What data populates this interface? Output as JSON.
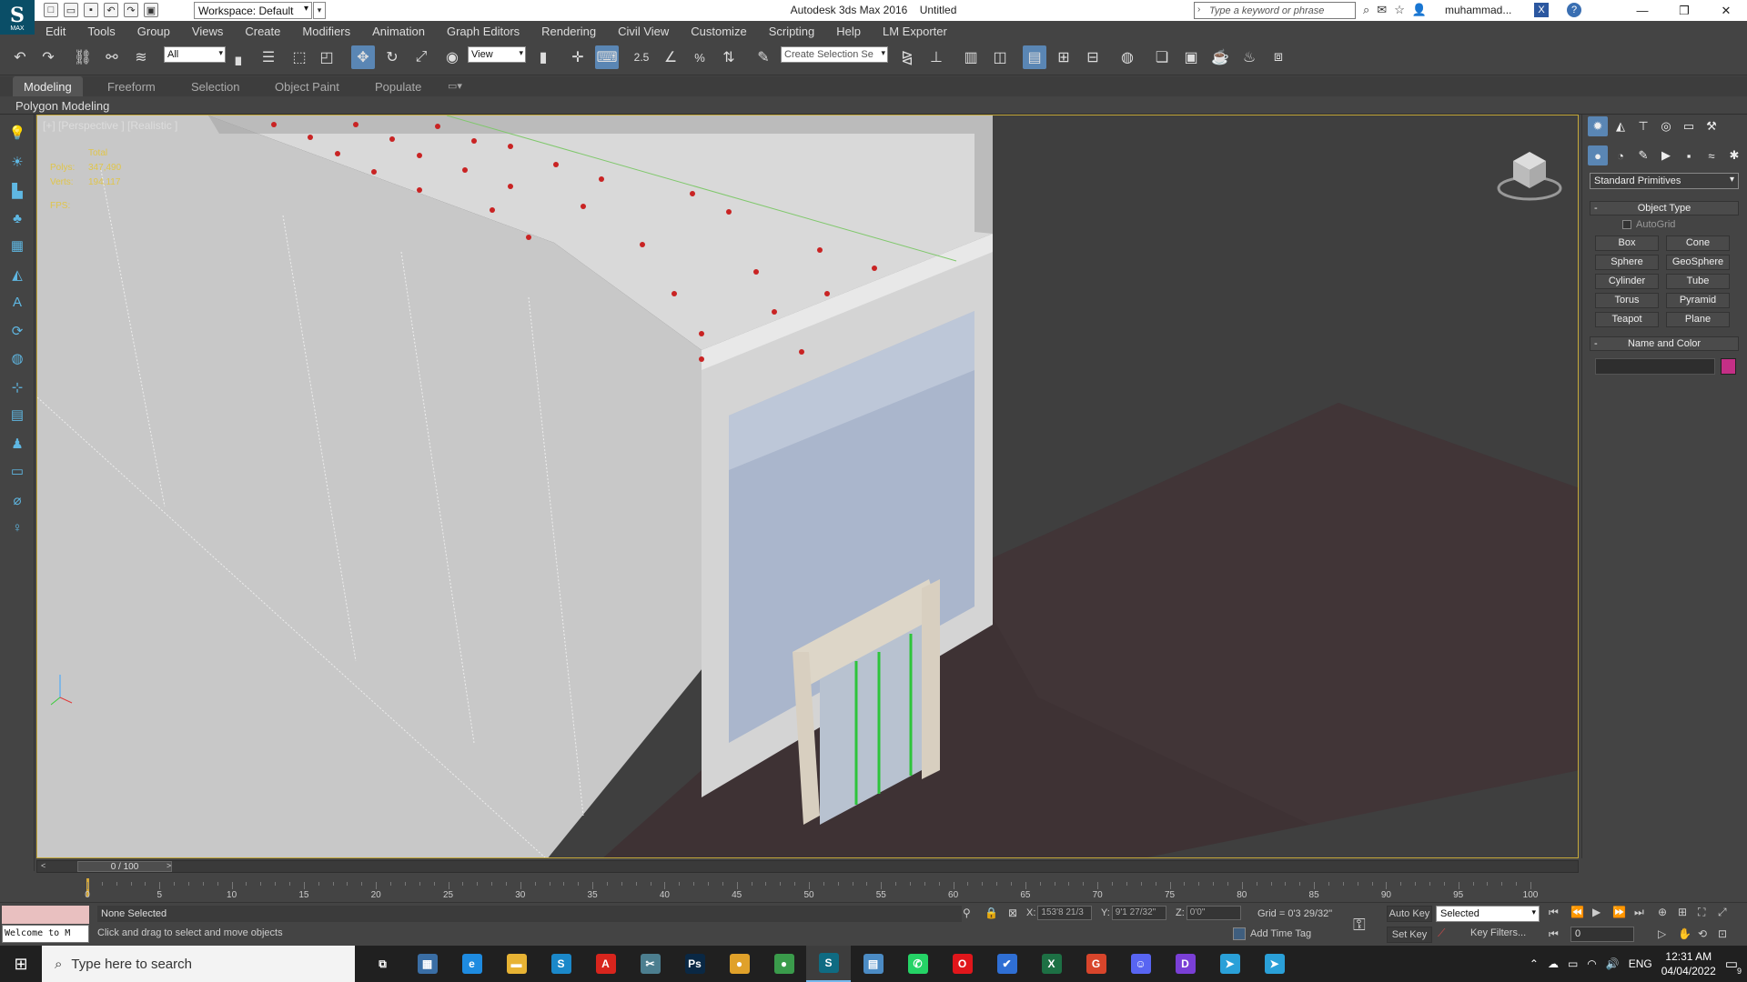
{
  "title_bar": {
    "app_title": "Autodesk 3ds Max 2016",
    "doc_title": "Untitled",
    "workspace": "Workspace: Default",
    "search_placeholder": "Type a keyword or phrase",
    "user": "muhammad...",
    "logo_text": "MAX"
  },
  "menu": [
    "Edit",
    "Tools",
    "Group",
    "Views",
    "Create",
    "Modifiers",
    "Animation",
    "Graph Editors",
    "Rendering",
    "Civil View",
    "Customize",
    "Scripting",
    "Help",
    "LM Exporter"
  ],
  "toolbar": {
    "filter": "All",
    "ref_coord": "View",
    "snap_value": "2.5",
    "selection_set_placeholder": "Create Selection Se"
  },
  "ribbon": {
    "tabs": [
      "Modeling",
      "Freeform",
      "Selection",
      "Object Paint",
      "Populate"
    ],
    "active_tab": "Modeling",
    "panel": "Polygon Modeling"
  },
  "viewport": {
    "label": "[+] [Perspective ] [Realistic ]",
    "stats": {
      "total_label": "Total",
      "polys_label": "Polys:",
      "polys": "347,490",
      "verts_label": "Verts:",
      "verts": "194,117",
      "fps_label": "FPS:"
    }
  },
  "command_panel": {
    "dropdown": "Standard Primitives",
    "object_type_title": "Object Type",
    "autogrid": "AutoGrid",
    "buttons": [
      "Box",
      "Cone",
      "Sphere",
      "GeoSphere",
      "Cylinder",
      "Tube",
      "Torus",
      "Pyramid",
      "Teapot",
      "Plane"
    ],
    "name_color_title": "Name and Color",
    "object_color": "#c42f86"
  },
  "timeline": {
    "frame_display": "0 / 100",
    "ticks": [
      0,
      5,
      10,
      15,
      20,
      25,
      30,
      35,
      40,
      45,
      50,
      55,
      60,
      65,
      70,
      75,
      80,
      85,
      90,
      95,
      100
    ]
  },
  "status": {
    "maxscript_text": "Welcome to M",
    "selection": "None Selected",
    "prompt": "Click and drag to select and move objects",
    "x_label": "X:",
    "x_value": "153'8 21/3",
    "y_label": "Y:",
    "y_value": "9'1 27/32\"",
    "z_label": "Z:",
    "z_value": "0'0\"",
    "grid": "Grid = 0'3 29/32\"",
    "add_time_tag": "Add Time Tag",
    "auto_key": "Auto Key",
    "set_key": "Set Key",
    "key_mode": "Selected",
    "key_filters": "Key Filters...",
    "current_frame": "0"
  },
  "taskbar": {
    "search_placeholder": "Type here to search",
    "language": "ENG",
    "time": "12:31 AM",
    "date": "04/04/2022",
    "notification_count": "9",
    "apps": [
      {
        "name": "task-view",
        "label": "⧉",
        "color": "#202020"
      },
      {
        "name": "calculator",
        "label": "▦",
        "color": "#3a6ea5"
      },
      {
        "name": "edge",
        "label": "e",
        "color": "#1e8be0"
      },
      {
        "name": "file-explorer",
        "label": "▬",
        "color": "#e7b334"
      },
      {
        "name": "app-s",
        "label": "S",
        "color": "#1b88c9"
      },
      {
        "name": "acrobat",
        "label": "A",
        "color": "#d8251d"
      },
      {
        "name": "snipping",
        "label": "✂",
        "color": "#4c7e8f"
      },
      {
        "name": "photoshop",
        "label": "Ps",
        "color": "#0a2844"
      },
      {
        "name": "chrome",
        "label": "●",
        "color": "#e0a12a"
      },
      {
        "name": "chrome-2",
        "label": "●",
        "color": "#3a9b4b"
      },
      {
        "name": "3dsmax",
        "label": "S",
        "color": "#0f6b82"
      },
      {
        "name": "notes",
        "label": "▤",
        "color": "#4b8bc4"
      },
      {
        "name": "whatsapp",
        "label": "✆",
        "color": "#25d366"
      },
      {
        "name": "opera",
        "label": "O",
        "color": "#e0161b"
      },
      {
        "name": "todo",
        "label": "✔",
        "color": "#2f6fd4"
      },
      {
        "name": "excel",
        "label": "X",
        "color": "#1d7044"
      },
      {
        "name": "grammarly",
        "label": "G",
        "color": "#d8452b"
      },
      {
        "name": "discord",
        "label": "☺",
        "color": "#5865f2"
      },
      {
        "name": "app-purple",
        "label": "D",
        "color": "#7a3fd6"
      },
      {
        "name": "telegram",
        "label": "➤",
        "color": "#2aa0d8"
      },
      {
        "name": "telegram-2",
        "label": "➤",
        "color": "#2aa0d8"
      }
    ]
  }
}
